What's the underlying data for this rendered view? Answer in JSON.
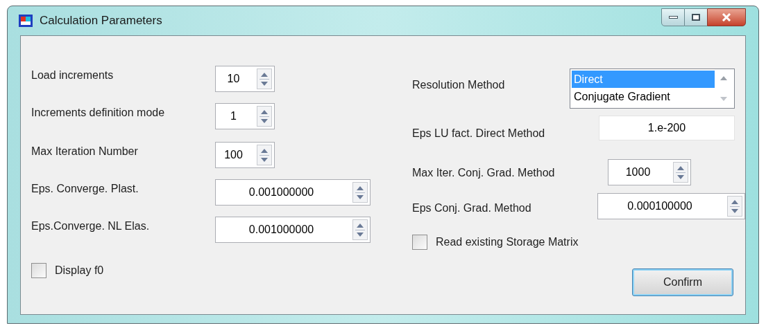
{
  "window": {
    "title": "Calculation Parameters"
  },
  "left": [
    {
      "kind": "spinner",
      "label": "Load increments",
      "value": "10"
    },
    {
      "kind": "spinner",
      "label": "Increments definition mode",
      "value": "1"
    },
    {
      "kind": "spinner",
      "label": "Max Iteration Number",
      "value": "100"
    },
    {
      "kind": "spinner",
      "label": "Eps. Converge. Plast.",
      "value": "0.001000000"
    },
    {
      "kind": "spinner",
      "label": "Eps.Converge. NL Elas.",
      "value": "0.001000000"
    },
    {
      "kind": "checkbox",
      "label": "Display f0",
      "checked": false
    }
  ],
  "right": [
    {
      "kind": "listbox",
      "label": "Resolution Method",
      "items": [
        {
          "label": "Direct",
          "selected": true
        },
        {
          "label": "Conjugate Gradient",
          "selected": false
        }
      ]
    },
    {
      "kind": "textfield",
      "label": "Eps LU fact. Direct Method",
      "value": "1.e-200"
    },
    {
      "kind": "spinner",
      "label": "Max Iter. Conj. Grad. Method",
      "value": "1000"
    },
    {
      "kind": "spinner",
      "label": "Eps Conj. Grad. Method",
      "value": "0.000100000"
    },
    {
      "kind": "checkbox",
      "label": "Read existing Storage Matrix",
      "checked": false
    }
  ],
  "confirm_button": "Confirm"
}
